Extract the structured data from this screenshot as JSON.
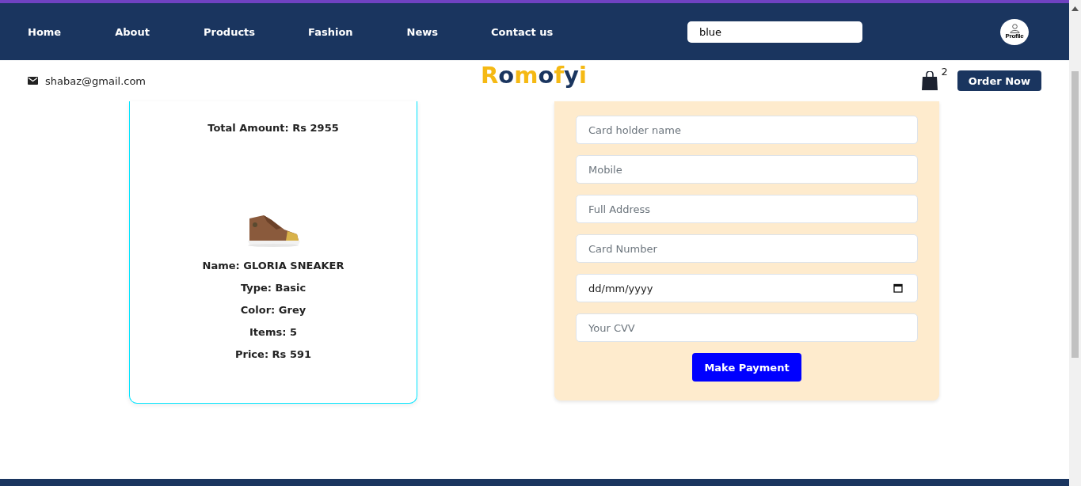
{
  "nav": {
    "links": [
      "Home",
      "About",
      "Products",
      "Fashion",
      "News",
      "Contact us"
    ],
    "search": {
      "value": "blue"
    },
    "profile": {
      "label": "Profile"
    }
  },
  "subheader": {
    "email": "shabaz@gmail.com",
    "logo": "Romofyi",
    "cart_count": "2",
    "order_button": "Order Now"
  },
  "order_card": {
    "total": "Total Amount: Rs 2955",
    "product": {
      "kind": "picture"
    },
    "details": [
      "Name: GLORIA SNEAKER",
      "Type: Basic",
      "Color: Grey",
      "Items: 5",
      "Price: Rs 591"
    ]
  },
  "payment_form": {
    "fields": [
      {
        "kind": "text",
        "placeholder": "Card holder name"
      },
      {
        "kind": "text",
        "placeholder": "Mobile"
      },
      {
        "kind": "text",
        "placeholder": "Full Address"
      },
      {
        "kind": "text",
        "placeholder": "Card Number"
      },
      {
        "kind": "date",
        "value": "dd/mm/yyyy"
      },
      {
        "kind": "text",
        "placeholder": "Your CVV"
      }
    ],
    "submit": "Make Payment"
  }
}
